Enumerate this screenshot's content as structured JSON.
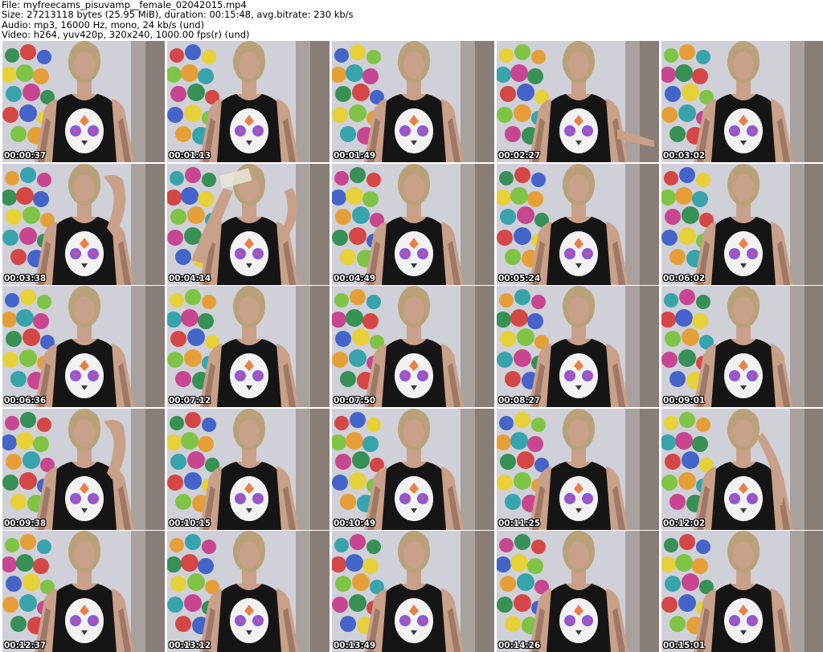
{
  "header": {
    "file_line": "File: myfreecams_pisuvamp__female_02042015.mp4",
    "size_line": "Size: 27213118 bytes (25.95 MiB), duration: 00:15:48, avg.bitrate: 230 kb/s",
    "audio_line": "Audio: mp3, 16000 Hz, mono, 24 kb/s (und)",
    "video_line": "Video: h264, yuv420p, 320x240, 1000.00 fps(r) (und)"
  },
  "frames": [
    {
      "time": "00:00:37",
      "pose": "neutral"
    },
    {
      "time": "00:01:13",
      "pose": "neutral"
    },
    {
      "time": "00:01:49",
      "pose": "neutral"
    },
    {
      "time": "00:02:27",
      "pose": "arm-out"
    },
    {
      "time": "00:03:02",
      "pose": "neutral"
    },
    {
      "time": "00:03:38",
      "pose": "hand-hair"
    },
    {
      "time": "00:04:14",
      "pose": "drinking"
    },
    {
      "time": "00:04:49",
      "pose": "neutral"
    },
    {
      "time": "00:05:24",
      "pose": "neutral"
    },
    {
      "time": "00:06:02",
      "pose": "neutral"
    },
    {
      "time": "00:06:36",
      "pose": "neutral"
    },
    {
      "time": "00:07:12",
      "pose": "neutral"
    },
    {
      "time": "00:07:50",
      "pose": "neutral"
    },
    {
      "time": "00:08:27",
      "pose": "neutral"
    },
    {
      "time": "00:09:01",
      "pose": "neutral"
    },
    {
      "time": "00:09:38",
      "pose": "hand-hair"
    },
    {
      "time": "00:10:15",
      "pose": "neutral"
    },
    {
      "time": "00:10:49",
      "pose": "neutral"
    },
    {
      "time": "00:11:25",
      "pose": "neutral"
    },
    {
      "time": "00:12:02",
      "pose": "hand-face"
    },
    {
      "time": "00:12:37",
      "pose": "neutral"
    },
    {
      "time": "00:13:12",
      "pose": "neutral"
    },
    {
      "time": "00:13:49",
      "pose": "neutral"
    },
    {
      "time": "00:14:26",
      "pose": "neutral"
    },
    {
      "time": "00:15:01",
      "pose": "neutral"
    }
  ],
  "colors": {
    "background": "#ffffff",
    "wall": "#cfd0d8",
    "shadow_wall": "#8a7a6e",
    "shirt": "#151515",
    "skin": "#c9a08a",
    "hair": "#b9a17a",
    "timestamp_text": "#ffffff",
    "circle_palette": [
      "#2a8a4a",
      "#d63a3a",
      "#3a5ac8",
      "#e8d02a",
      "#7ac23a",
      "#e89a2a",
      "#2aa0a8",
      "#c83a8a"
    ]
  }
}
